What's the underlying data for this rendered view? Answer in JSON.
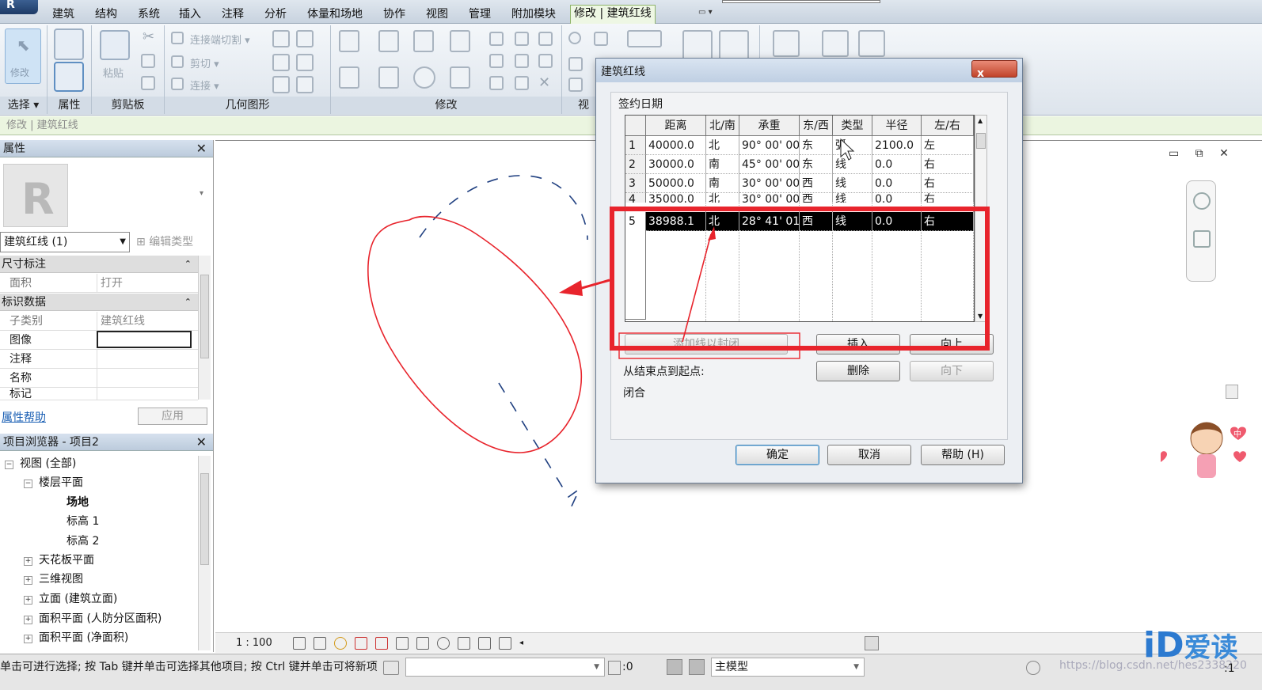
{
  "ribbon": {
    "app_button": "R",
    "tabs": [
      "建筑",
      "结构",
      "系统",
      "插入",
      "注释",
      "分析",
      "体量和场地",
      "协作",
      "视图",
      "管理",
      "附加模块",
      "修改 | 建筑红线"
    ],
    "panels": {
      "select_label": "选择 ▾",
      "properties_label": "属性",
      "clipboard_label": "剪贴板",
      "geometry_label": "几何图形",
      "modify_label": "修改",
      "view_label": "视"
    },
    "tools": {
      "modify": "修改",
      "paste": "粘贴",
      "cope": "连接端切割",
      "cut": "剪切",
      "join": "连接"
    }
  },
  "context_bar": "修改 | 建筑红线",
  "properties": {
    "title": "属性",
    "type_selector": "建筑红线 (1)",
    "edit_type": "编辑类型",
    "sections": [
      {
        "title": "尺寸标注",
        "rows": [
          {
            "key": "面积",
            "value": "打开"
          }
        ]
      },
      {
        "title": "标识数据",
        "rows": [
          {
            "key": "子类别",
            "value": "建筑红线"
          },
          {
            "key": "图像",
            "value": ""
          },
          {
            "key": "注释",
            "value": ""
          },
          {
            "key": "名称",
            "value": ""
          },
          {
            "key": "标记",
            "value": ""
          }
        ]
      }
    ],
    "help_link": "属性帮助",
    "apply": "应用"
  },
  "browser": {
    "title": "项目浏览器 - 项目2",
    "items": [
      {
        "label": "视图 (全部)",
        "level": 0,
        "toggle": "⊟"
      },
      {
        "label": "楼层平面",
        "level": 1,
        "toggle": "⊟"
      },
      {
        "label": "场地",
        "level": 2,
        "toggle": ""
      },
      {
        "label": "标高 1",
        "level": 2,
        "toggle": ""
      },
      {
        "label": "标高 2",
        "level": 2,
        "toggle": ""
      },
      {
        "label": "天花板平面",
        "level": 1,
        "toggle": "⊞"
      },
      {
        "label": "三维视图",
        "level": 1,
        "toggle": "⊞"
      },
      {
        "label": "立面 (建筑立面)",
        "level": 1,
        "toggle": "⊞"
      },
      {
        "label": "面积平面 (人防分区面积)",
        "level": 1,
        "toggle": "⊞"
      },
      {
        "label": "面积平面 (净面积)",
        "level": 1,
        "toggle": "⊞"
      }
    ]
  },
  "view_bar": {
    "scale": "1 : 100"
  },
  "status": {
    "message": "单击可进行选择; 按 Tab 键并单击可选择其他项目; 按 Ctrl 键并单击可将新项目添加到选择集",
    "count": ":0",
    "model": "主模型",
    "url": "https://blog.csdn.net/hes2338220",
    "filter_count": ":1"
  },
  "overlay": {
    "logo_i": "iD",
    "logo_text": "爱读",
    "badge_char": "中"
  },
  "dialog": {
    "title": "建筑红线",
    "close": "x",
    "group_label": "签约日期",
    "columns": [
      "",
      "距离",
      "北/南",
      "承重",
      "东/西",
      "类型",
      "半径",
      "左/右"
    ],
    "rows": [
      {
        "num": "1",
        "distance": "40000.0",
        "ns": "北",
        "bearing": "90° 00' 00",
        "ew": "东",
        "type": "弧",
        "radius": "2100.0",
        "lr": "左"
      },
      {
        "num": "2",
        "distance": "30000.0",
        "ns": "南",
        "bearing": "45° 00' 00",
        "ew": "东",
        "type": "线",
        "radius": "0.0",
        "lr": "右"
      },
      {
        "num": "3",
        "distance": "50000.0",
        "ns": "南",
        "bearing": "30° 00' 00",
        "ew": "西",
        "type": "线",
        "radius": "0.0",
        "lr": "右"
      },
      {
        "num": "4",
        "distance": "35000.0",
        "ns": "北",
        "bearing": "30° 00' 00",
        "ew": "西",
        "type": "线",
        "radius": "0.0",
        "lr": "右"
      },
      {
        "num": "5",
        "distance": "38988.1",
        "ns": "北",
        "bearing": "28° 41' 01",
        "ew": "西",
        "type": "线",
        "radius": "0.0",
        "lr": "右"
      }
    ],
    "selected_row": 5,
    "buttons": {
      "add_line": "添加线以封闭",
      "insert": "插入",
      "move_up": "向上",
      "delete": "删除",
      "move_down": "向下",
      "ok": "确定",
      "cancel": "取消",
      "help": "帮助 (H)"
    },
    "end_to_start_label": "从结束点到起点:",
    "closed_label": "闭合"
  },
  "colors": {
    "annotation_red": "#e8242c",
    "selection_black": "#000000",
    "context_green": "#ebf5e0",
    "link_blue": "#1a5fb4"
  }
}
